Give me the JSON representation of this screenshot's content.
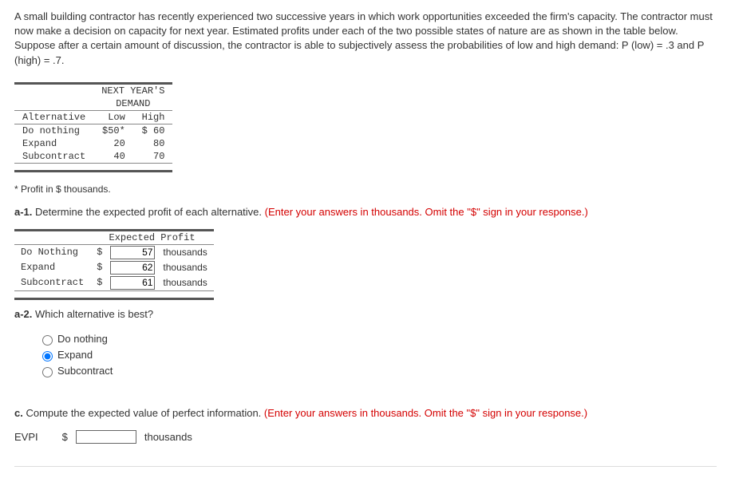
{
  "problem": {
    "paragraph": "A small building contractor has recently experienced two successive years in which work opportunities exceeded the firm's capacity. The contractor must now make a decision on capacity for next year. Estimated profits under each of the two possible states of nature are as shown in the table below. Suppose after a certain amount of discussion, the contractor is able to subjectively assess the probabilities of low and high demand: P (low) = .3 and P (high) = .7."
  },
  "payoff": {
    "header_top": "NEXT YEAR'S",
    "header_sub": "DEMAND",
    "col_alt": "Alternative",
    "col_low": "Low",
    "col_high": "High",
    "rows": [
      {
        "alt": "Do nothing",
        "low": "$50*",
        "high": "$ 60"
      },
      {
        "alt": "Expand",
        "low": "20",
        "high": "80"
      },
      {
        "alt": "Subcontract",
        "low": "40",
        "high": "70"
      }
    ]
  },
  "footnote": "* Profit in $ thousands.",
  "a1": {
    "prompt_bold": "a-1.",
    "prompt_rest": " Determine the expected profit of each alternative. ",
    "prompt_red": "(Enter your answers in thousands. Omit the \"$\" sign in your response.)",
    "table_header": "Expected Profit",
    "rows": [
      {
        "label": "Do Nothing",
        "dollar": "$",
        "value": "57",
        "unit": "thousands"
      },
      {
        "label": "Expand",
        "dollar": "$",
        "value": "62",
        "unit": "thousands"
      },
      {
        "label": "Subcontract",
        "dollar": "$",
        "value": "61",
        "unit": "thousands"
      }
    ]
  },
  "a2": {
    "prompt_bold": "a-2.",
    "prompt_rest": " Which alternative is best?",
    "options": [
      {
        "label": "Do nothing",
        "checked": false
      },
      {
        "label": "Expand",
        "checked": true
      },
      {
        "label": "Subcontract",
        "checked": false
      }
    ]
  },
  "c": {
    "prompt_bold": "c.",
    "prompt_rest": " Compute the expected value of perfect information. ",
    "prompt_red": "(Enter your answers in thousands. Omit the \"$\" sign in your response.)",
    "label": "EVPI",
    "dollar": "$",
    "value": "",
    "unit": "thousands"
  }
}
